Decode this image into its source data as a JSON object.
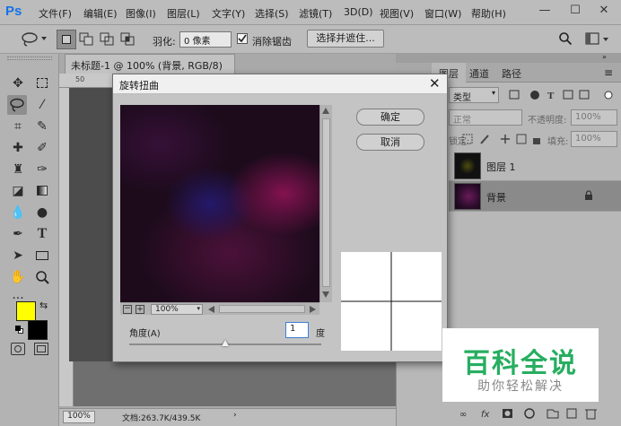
{
  "app": {
    "logo": "Ps"
  },
  "menu": [
    "文件(F)",
    "编辑(E)",
    "图像(I)",
    "图层(L)",
    "文字(Y)",
    "选择(S)",
    "滤镜(T)",
    "3D(D)",
    "视图(V)",
    "窗口(W)",
    "帮助(H)"
  ],
  "window_controls": {
    "minimize": "—",
    "maximize": "☐",
    "close": "✕"
  },
  "options": {
    "feather_label": "羽化:",
    "feather_value": "0 像素",
    "antialias_label": "消除锯齿",
    "antialias_checked": true,
    "select_mask_label": "选择并遮住..."
  },
  "document": {
    "tab_title": "未标题-1 @ 100% (背景, RGB/8) *",
    "tab_close": "×",
    "ruler_mark": "50",
    "zoom": "100%",
    "doc_info": "文档:263.7K/439.5K"
  },
  "panel": {
    "tabs": [
      "图层",
      "通道",
      "路径"
    ],
    "kind_label": "类型",
    "blend_mode": "正常",
    "opacity_label": "不透明度:",
    "opacity_value": "100%",
    "lock_label": "锁定:",
    "fill_label": "填充:",
    "fill_value": "100%",
    "layers": [
      {
        "name": "图层 1",
        "selected": false,
        "locked": false
      },
      {
        "name": "背景",
        "selected": true,
        "locked": true
      }
    ]
  },
  "dialog": {
    "title": "旋转扭曲",
    "ok_label": "确定",
    "cancel_label": "取消",
    "zoom_value": "100%",
    "angle_label": "角度(A)",
    "angle_value": "1",
    "angle_unit": "度",
    "angle_slider_fraction": 0.5
  },
  "watermark": {
    "title": "百科全说",
    "subtitle": "助你轻松解决"
  },
  "colors": {
    "foreground": "#ffff00",
    "background": "#000000",
    "accent_green": "#27ae60",
    "ps_blue": "#1473e6"
  }
}
